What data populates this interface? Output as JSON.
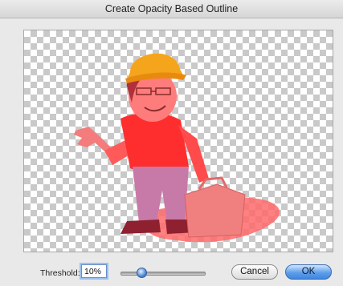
{
  "window": {
    "title": "Create Opacity Based Outline"
  },
  "preview": {
    "image": "cartoon-construction-worker-with-toolbox-and-wrench"
  },
  "threshold": {
    "label": "Threshold:",
    "value": "10%",
    "level": 0.1
  },
  "buttons": {
    "cancel": "Cancel",
    "ok": "OK"
  },
  "colors": {
    "ok_button": "#5f9eea",
    "outline_overlay": "#ff3b3b",
    "hard_hat": "#f5a51c"
  }
}
